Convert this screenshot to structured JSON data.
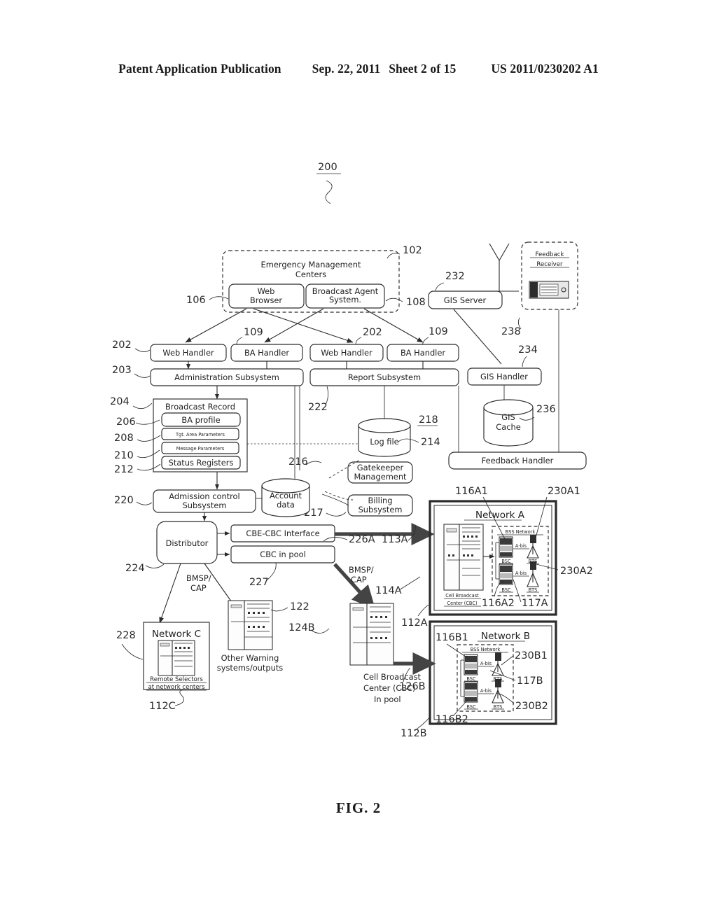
{
  "header": {
    "publication": "Patent Application Publication",
    "date": "Sep. 22, 2011",
    "sheet": "Sheet 2 of 15",
    "number": "US 2011/0230202 A1"
  },
  "figure": {
    "caption": "FIG. 2",
    "system_ref": "200"
  },
  "blocks": {
    "emergency_centers": "Emergency Management\nCenters",
    "emergency_centers_l1": "Emergency Management",
    "emergency_centers_l2": "Centers",
    "web_browser_l1": "Web",
    "web_browser_l2": "Browser",
    "broadcast_agent_l1": "Broadcast Agent",
    "broadcast_agent_l2": "System.",
    "gis_server": "GIS Server",
    "feedback_receiver_l1": "Feedback",
    "feedback_receiver_l2": "Receiver",
    "web_handler_1": "Web Handler",
    "ba_handler_1": "BA Handler",
    "web_handler_2": "Web Handler",
    "ba_handler_2": "BA Handler",
    "gis_handler": "GIS Handler",
    "administration_subsystem": "Administration Subsystem",
    "report_subsystem": "Report Subsystem",
    "broadcast_record": "Broadcast Record",
    "ba_profile": "BA profile",
    "tgt_area_parameters": "Tgt. Area Parameters",
    "message_parameters": "Message Parameters",
    "status_registers": "Status Registers",
    "gis_cache_l1": "GIS",
    "gis_cache_l2": "Cache",
    "log_file": "Log file",
    "gatekeeper_l1": "Gatekeeper",
    "gatekeeper_l2": "Management",
    "billing_l1": "Billing",
    "billing_l2": "Subsystem",
    "feedback_handler": "Feedback Handler",
    "admission_control_l1": "Admission control",
    "admission_control_l2": "Subsystem",
    "account_data_l1": "Account",
    "account_data_l2": "data",
    "distributor": "Distributor",
    "cbe_cbc_interface": "CBE-CBC Interface",
    "cbc_in_pool": "CBC in pool",
    "network_a": "Network A",
    "network_b": "Network B",
    "network_c": "Network C",
    "bss_network": "BSS Network",
    "bsc": "BSC",
    "bts": "BTS",
    "abis": "A-bis",
    "cbc_net_l1": "Cell Broadcast",
    "cbc_net_l2": "Center (CBC)",
    "remote_selectors_l1": "Remote Selectors",
    "remote_selectors_l2": "at network centers",
    "other_warning_l1": "Other Warning",
    "other_warning_l2": "systems/outputs",
    "cbc_pool_l1": "Cell Broadcast",
    "cbc_pool_l2": "Center (CBC)",
    "cbc_pool_l3": "In pool",
    "bmsp_cap_l1": "BMSP/",
    "bmsp_cap_l2": "CAP"
  },
  "refs": {
    "r102": "102",
    "r106": "106",
    "r108": "108",
    "r109a": "109",
    "r109b": "109",
    "r202a": "202",
    "r202b": "202",
    "r203": "203",
    "r204": "204",
    "r206": "206",
    "r208": "208",
    "r210": "210",
    "r212": "212",
    "r214": "214",
    "r216": "216",
    "r217": "217",
    "r218": "218",
    "r220": "220",
    "r222": "222",
    "r224": "224",
    "r226A": "226A",
    "r227": "227",
    "r228": "228",
    "r232": "232",
    "r234": "234",
    "r236": "236",
    "r238": "238",
    "r113A": "113A",
    "r114A": "114A",
    "r112A": "112A",
    "r112B": "112B",
    "r112C": "112C",
    "r116A1": "116A1",
    "r116A2": "116A2",
    "r116B1": "116B1",
    "r116B2": "116B2",
    "r117A": "117A",
    "r117B": "117B",
    "r122": "122",
    "r124B": "124B",
    "r126B": "126B",
    "r230A1": "230A1",
    "r230A2": "230A2",
    "r230B1": "230B1",
    "r230B2": "230B2"
  }
}
